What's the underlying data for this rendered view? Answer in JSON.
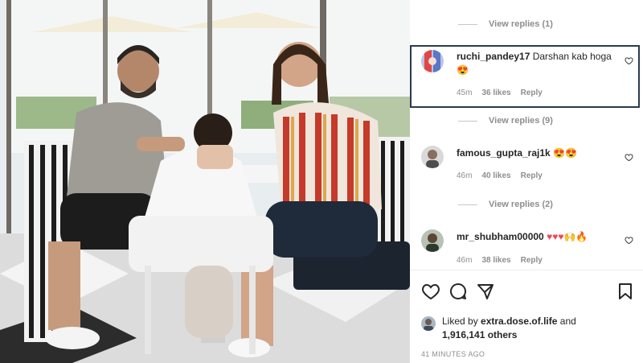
{
  "photo": {
    "alt_subject": "photo-post"
  },
  "comments_panel": {
    "top_view_replies": "View replies (1)",
    "comments": [
      {
        "username": "ruchi_pandey17",
        "text": "Darshan kab hoga",
        "emoji": "😍",
        "time": "45m",
        "likes": "36 likes",
        "reply": "Reply",
        "view_replies": "View replies (9)"
      },
      {
        "username": "famous_gupta_raj1k",
        "text": "😍😍",
        "emoji": "",
        "time": "46m",
        "likes": "40 likes",
        "reply": "Reply",
        "view_replies": "View replies (2)"
      },
      {
        "username": "mr_shubham00000",
        "text": "♥♥♥🙌🔥",
        "emoji": "",
        "time": "46m",
        "likes": "38 likes",
        "reply": "Reply",
        "view_replies": ""
      }
    ]
  },
  "actions": {
    "icons": [
      "heart-icon",
      "comment-icon",
      "share-icon",
      "bookmark-icon"
    ]
  },
  "likes_summary": {
    "prefix": "Liked by",
    "user": "extra.dose.of.life",
    "connector": "and",
    "count": "1,916,141 others"
  },
  "timestamp": "41 MINUTES AGO",
  "colors": {
    "highlight_border": "#2b3b4e",
    "muted": "#8e8e8e",
    "text": "#262626",
    "heart_red": "#ed4956"
  }
}
